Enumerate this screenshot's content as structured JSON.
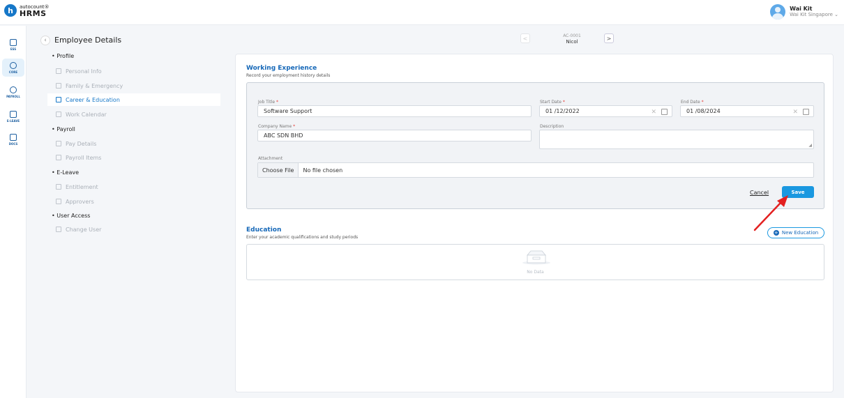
{
  "app": {
    "logo_top": "autocount®",
    "logo_bottom": "HRMS",
    "logo_letter": "h"
  },
  "user": {
    "name": "Wai Kit",
    "org": "Wai Kit Singapore ⌄"
  },
  "rail": [
    {
      "label": "ESS",
      "icon": "ess-icon"
    },
    {
      "label": "CORE",
      "icon": "core-icon",
      "active": true
    },
    {
      "label": "PAYROLL",
      "icon": "payroll-icon"
    },
    {
      "label": "E-LEAVE",
      "icon": "eleave-icon"
    },
    {
      "label": "DOCS",
      "icon": "docs-icon"
    }
  ],
  "subnav": {
    "title": "Employee Details",
    "groups": {
      "profile": "• Profile",
      "payroll": "• Payroll",
      "eleave": "• E-Leave",
      "access": "• User Access"
    },
    "items": {
      "personal": "Personal Info",
      "family": "Family & Emergency",
      "career": "Career & Education",
      "calendar": "Work Calendar",
      "pay_details": "Pay Details",
      "payroll_items": "Payroll Items",
      "entitlement": "Entitlement",
      "approvers": "Approvers",
      "change_user": "Change User"
    }
  },
  "record": {
    "code": "AC-0001",
    "name": "Nicol",
    "prev": "<",
    "next": ">"
  },
  "working_experience": {
    "title": "Working Experience",
    "subtitle": "Record your employment history details",
    "job_title_label": "Job Title",
    "job_title_value": "Software Support",
    "start_date_label": "Start Date",
    "start_date_value": "01 /12/2022",
    "end_date_label": "End Date",
    "end_date_value": "01 /08/2024",
    "company_label": "Company Name",
    "company_value": "ABC SDN BHD",
    "description_label": "Description",
    "attachment_label": "Attachment",
    "choose_file": "Choose File",
    "no_file": "No file chosen",
    "cancel": "Cancel",
    "save": "Save",
    "required_mark": "*"
  },
  "education": {
    "title": "Education",
    "subtitle": "Enter your academic qualifications and study periods",
    "new_button": "New Education",
    "empty": "No Data"
  },
  "colors": {
    "accent": "#1a98e0",
    "title_blue": "#1668b8",
    "annotation_arrow": "#e32020"
  }
}
